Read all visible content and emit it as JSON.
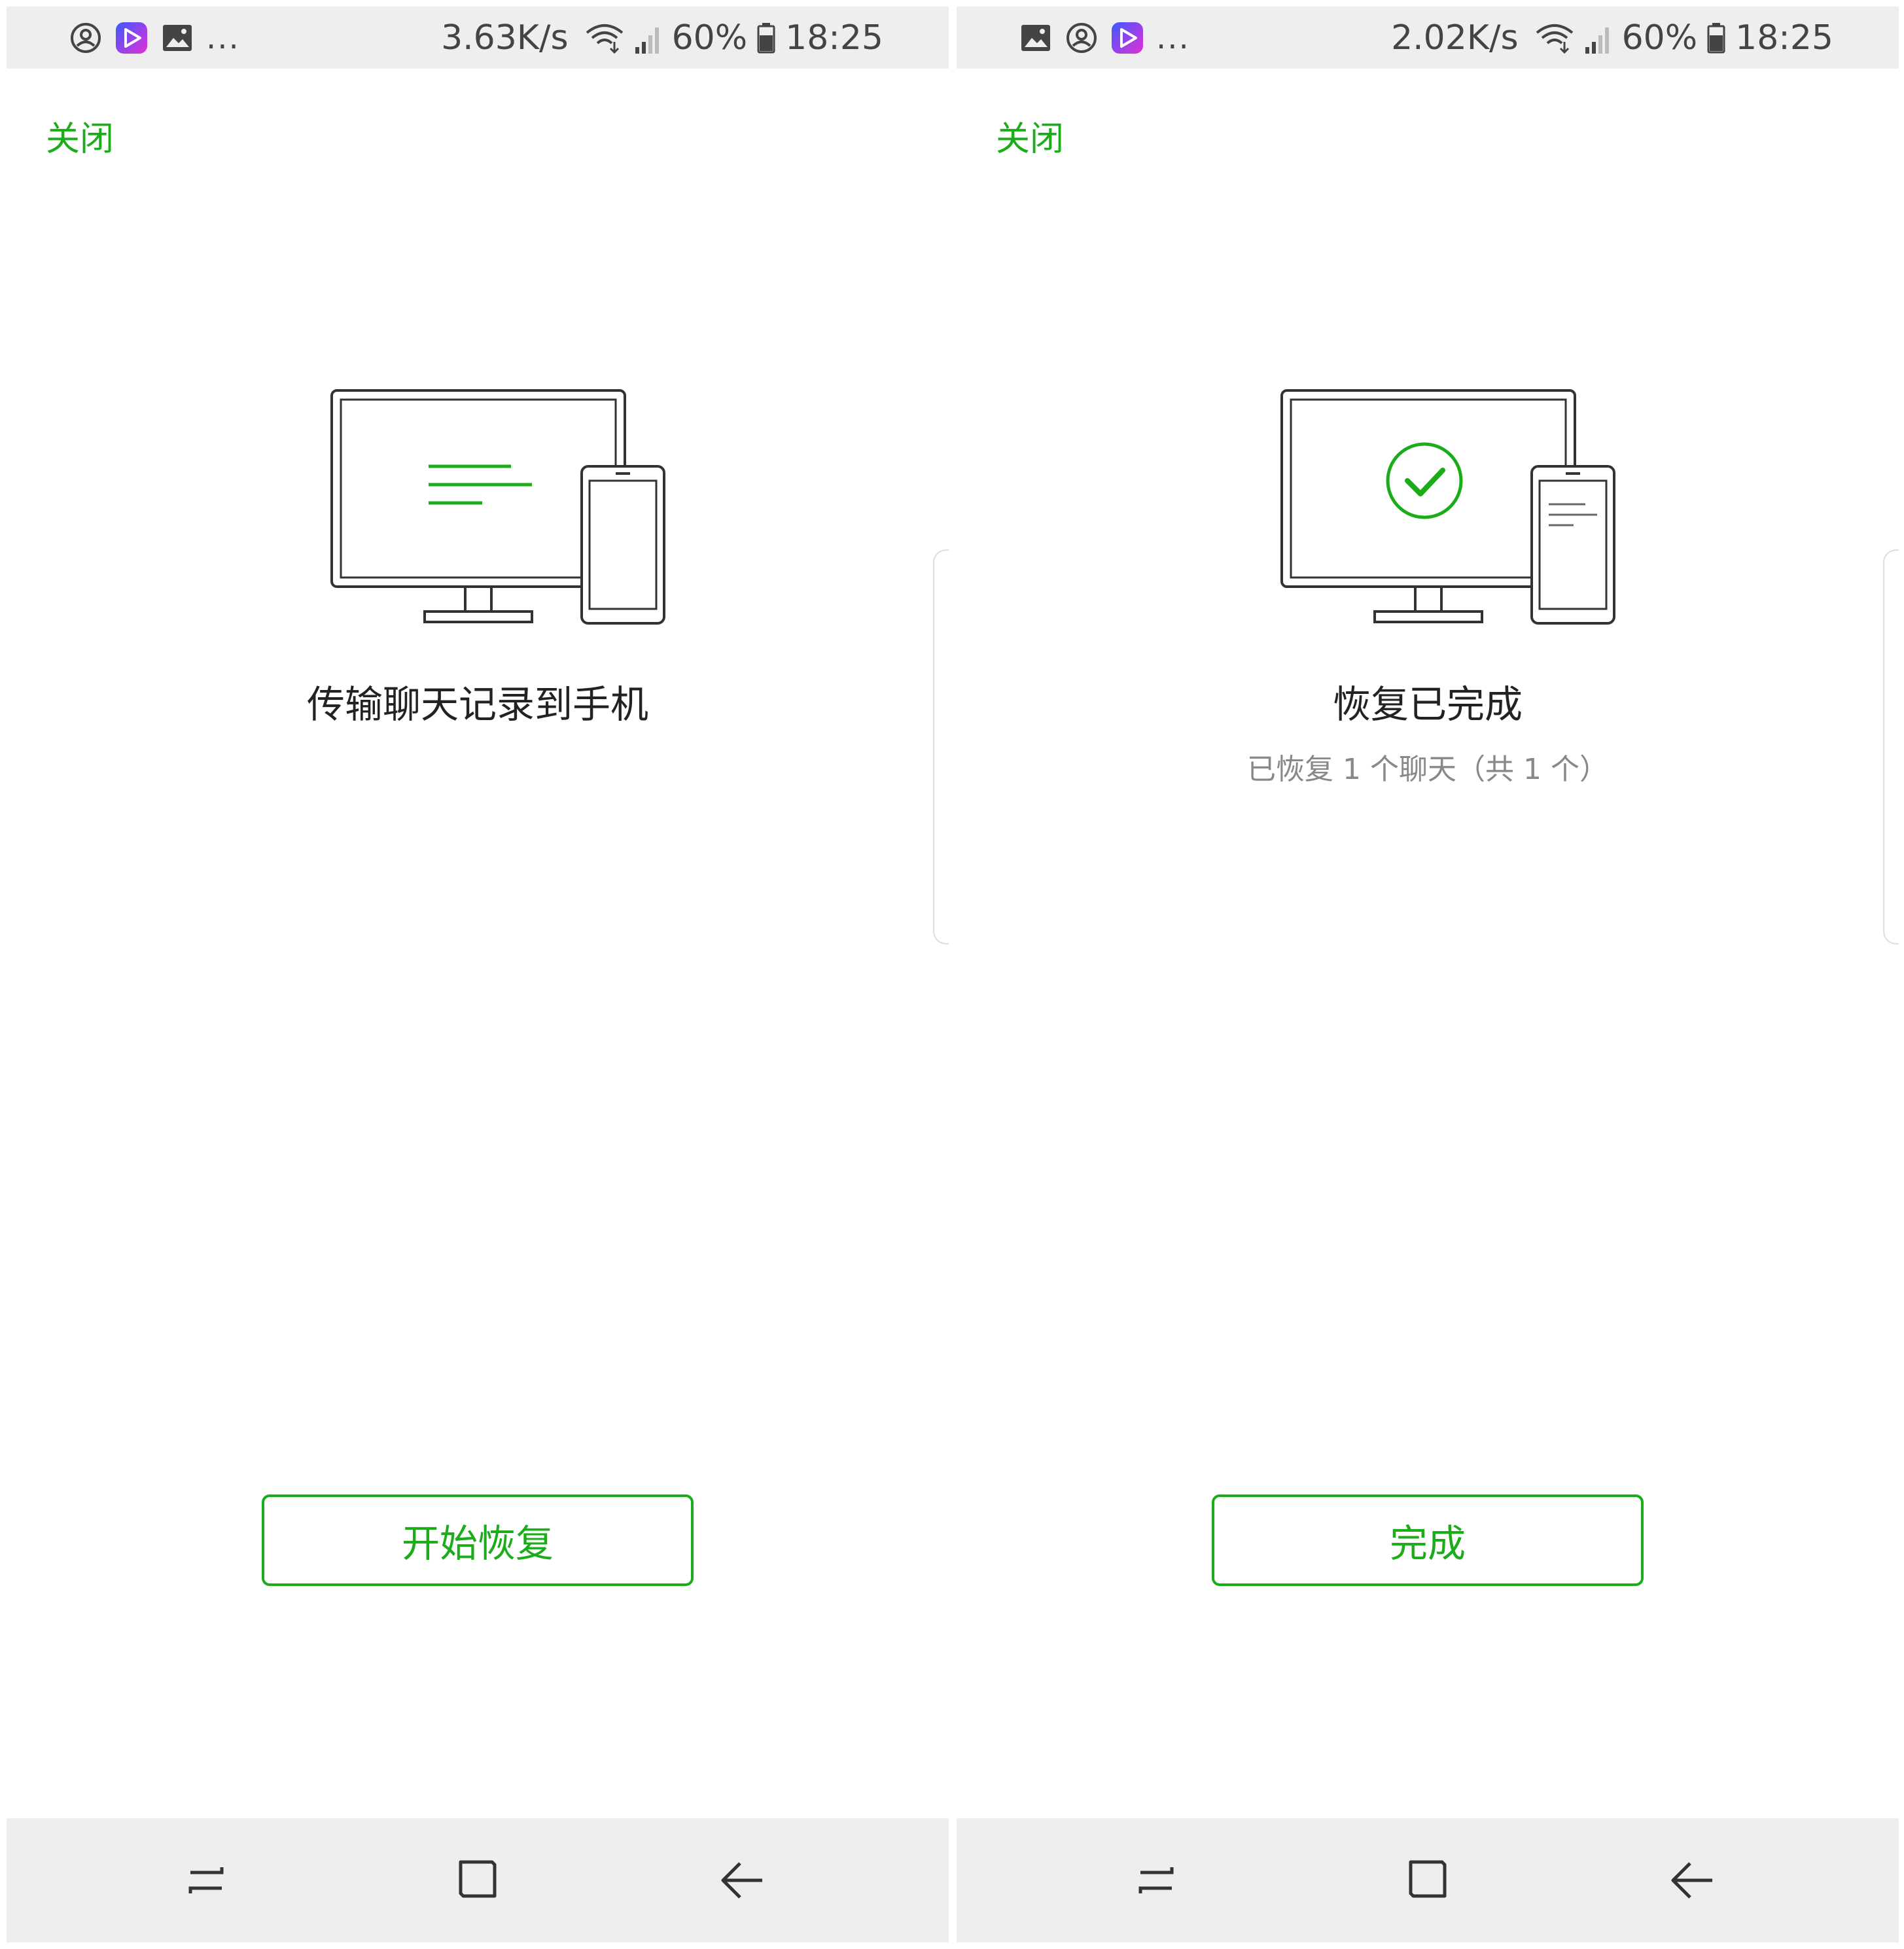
{
  "left": {
    "status": {
      "speed": "3.63K/s",
      "battery": "60%",
      "time": "18:25",
      "more": "..."
    },
    "close_label": "关闭",
    "title": "传输聊天记录到手机",
    "button_label": "开始恢复"
  },
  "right": {
    "status": {
      "speed": "2.02K/s",
      "battery": "60%",
      "time": "18:25",
      "more": "..."
    },
    "close_label": "关闭",
    "title": "恢复已完成",
    "subtitle": "已恢复 1 个聊天（共 1 个）",
    "button_label": "完成"
  },
  "colors": {
    "accent": "#1aad19",
    "bars": "#eeeeee"
  },
  "icons": [
    "account-icon",
    "video-app-icon",
    "gallery-icon",
    "wifi-icon",
    "signal-icon",
    "battery-icon",
    "monitor-phone-icon",
    "checkmark-icon",
    "recent-apps-icon",
    "home-icon",
    "back-icon"
  ]
}
